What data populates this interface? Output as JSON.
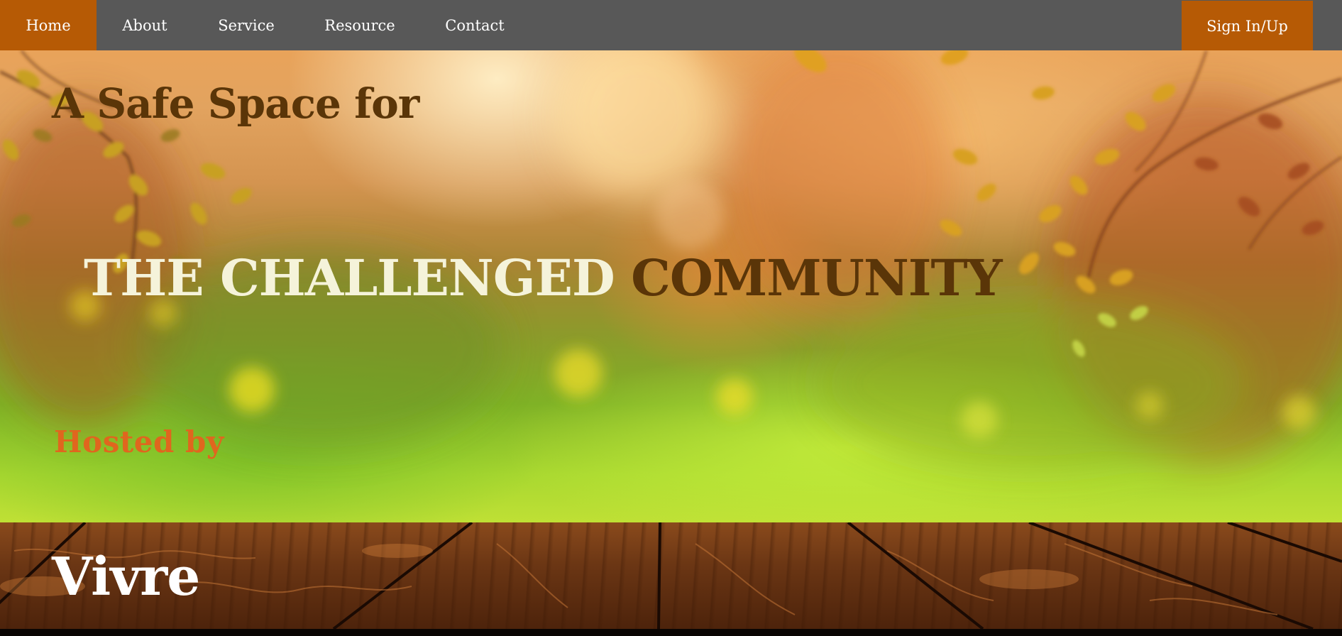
{
  "nav": {
    "items": [
      {
        "label": "Home",
        "active": true
      },
      {
        "label": "About",
        "active": false
      },
      {
        "label": "Service",
        "active": false
      },
      {
        "label": "Resource",
        "active": false
      },
      {
        "label": "Contact",
        "active": false
      }
    ],
    "sign_in_label": "Sign In/Up"
  },
  "hero": {
    "line1": "A Safe Space for",
    "line2_light": "THE CHALLENGED",
    "line2_dark": "COMMUNITY",
    "hosted_by": "Hosted by",
    "brand": "Vivre"
  },
  "colors": {
    "nav_bg": "#585858",
    "accent": "#b65a05",
    "heading_brown": "#5a3508",
    "heading_light": "#f5f3da",
    "hosted_orange": "#e0661e",
    "brand_white": "#ffffff"
  }
}
